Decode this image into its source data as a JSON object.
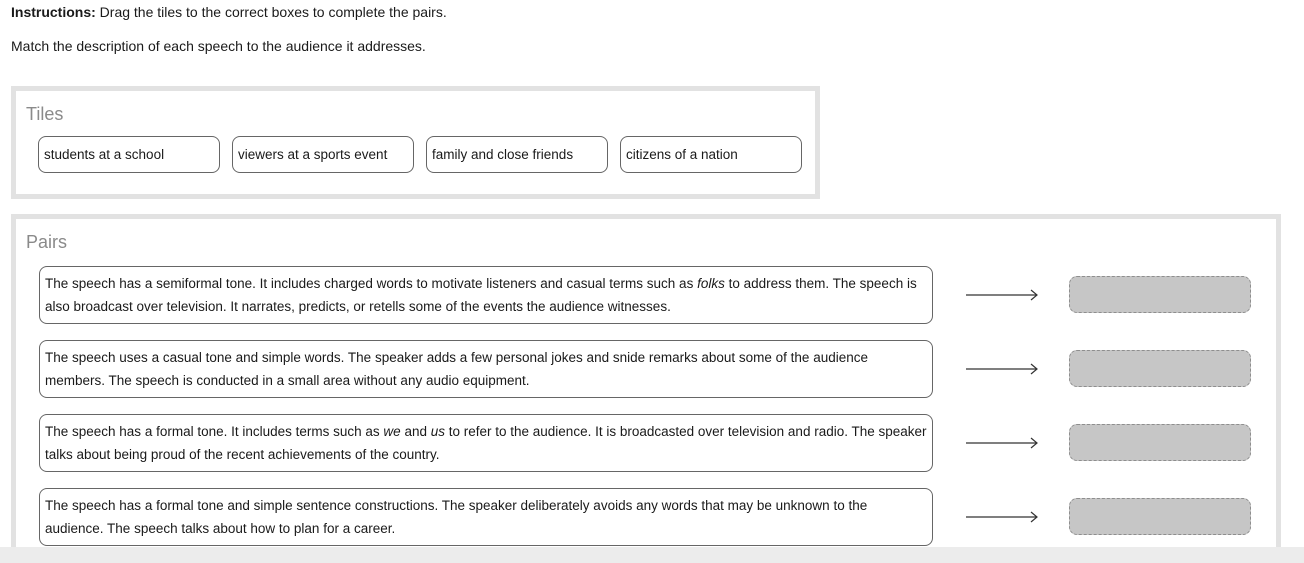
{
  "instructions": {
    "label": "Instructions:",
    "text": "Drag the tiles to the correct boxes to complete the pairs."
  },
  "question": "Match the description of each speech to the audience it addresses.",
  "tiles_panel": {
    "title": "Tiles",
    "tiles": [
      "students at a school",
      "viewers at a sports event",
      "family and close friends",
      "citizens of a nation"
    ]
  },
  "pairs_panel": {
    "title": "Pairs",
    "pairs": [
      {
        "parts": [
          "The speech has a semiformal tone. It includes charged words to motivate listeners and casual terms such as ",
          "folks",
          " to address them. The speech is also broadcast over television. It narrates, predicts, or retells some of the events the audience witnesses."
        ],
        "italic": [
          1
        ]
      },
      {
        "parts": [
          "The speech uses a casual tone and simple words. The speaker adds a few personal jokes and snide remarks about some of the audience members. The speech is conducted in a small area without any audio equipment."
        ],
        "italic": []
      },
      {
        "parts": [
          "The speech has a formal tone. It includes terms such as ",
          "we",
          " and ",
          "us",
          " to refer to the audience. It is broadcasted over television and radio. The speaker talks about being proud of the recent achievements of the country."
        ],
        "italic": [
          1,
          3
        ]
      },
      {
        "parts": [
          "The speech has a formal tone and simple sentence constructions. The speaker deliberately avoids any words that may be unknown to the audience. The speech talks about how to plan for a career."
        ],
        "italic": []
      }
    ]
  },
  "icons": {
    "arrow": "right-arrow-icon"
  },
  "colors": {
    "panel_border": "#e2e2e2",
    "panel_title": "#8a8a8a",
    "drop_zone": "#c6c6c6"
  }
}
